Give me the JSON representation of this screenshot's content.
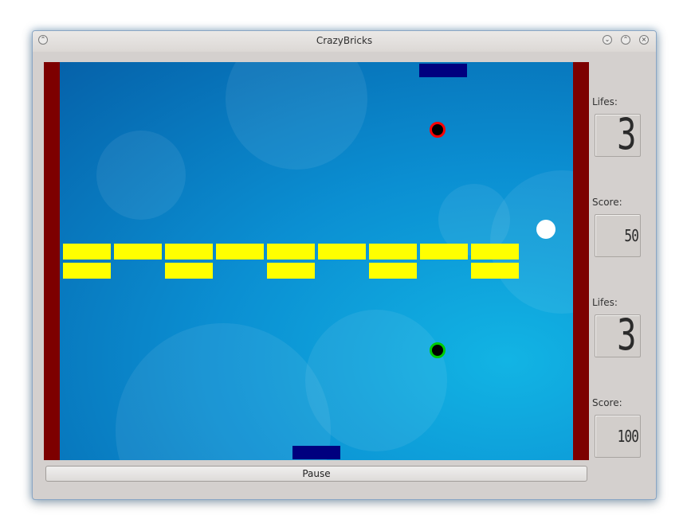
{
  "window": {
    "title": "CrazyBricks"
  },
  "side_panel": {
    "player1": {
      "lifes_label": "Lifes:",
      "lifes_value": "3",
      "score_label": "Score:",
      "score_value": "50"
    },
    "player2": {
      "lifes_label": "Lifes:",
      "lifes_value": "3",
      "score_label": "Score:",
      "score_value": "100"
    }
  },
  "controls": {
    "pause_label": "Pause"
  },
  "game": {
    "colors": {
      "wall": "#7d0000",
      "brick": "#ffff00",
      "paddle": "#00007f",
      "ball_top_outline": "#ff0000",
      "ball_bottom_outline": "#00cc00",
      "free_ball": "#ffffff"
    },
    "brick_rows": [
      [
        true,
        true,
        true,
        true,
        true,
        true,
        true,
        true,
        true
      ],
      [
        true,
        false,
        true,
        false,
        true,
        false,
        true,
        false,
        true
      ]
    ]
  }
}
